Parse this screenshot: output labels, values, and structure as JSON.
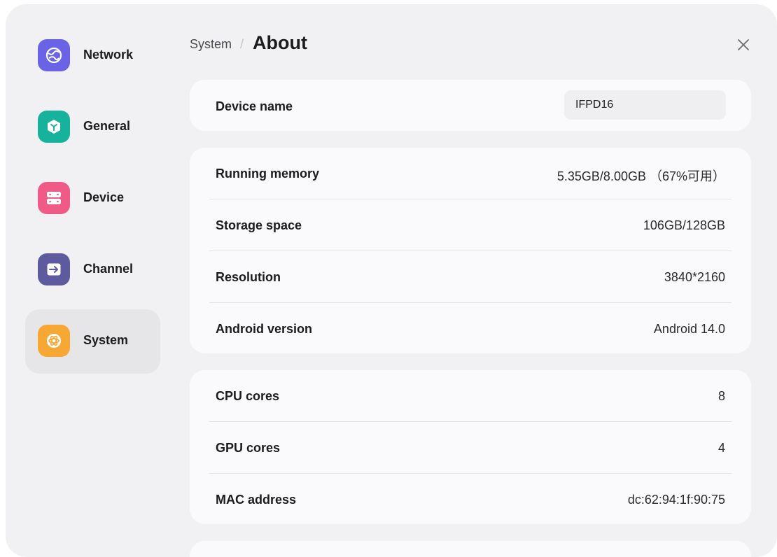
{
  "sidebar": {
    "items": [
      {
        "label": "Network",
        "icon": "network-globe-icon",
        "color": "#6b63e6"
      },
      {
        "label": "General",
        "icon": "general-cube-icon",
        "color": "#17b29b"
      },
      {
        "label": "Device",
        "icon": "device-server-icon",
        "color": "#ef5a86"
      },
      {
        "label": "Channel",
        "icon": "channel-input-icon",
        "color": "#5e5a9e"
      },
      {
        "label": "System",
        "icon": "system-atom-icon",
        "color": "#f7a733",
        "active": true
      }
    ]
  },
  "header": {
    "breadcrumb": "System",
    "separator": "/",
    "title": "About"
  },
  "device_name": {
    "label": "Device name",
    "value": "IFPD16"
  },
  "info_group_1": [
    {
      "label": "Running memory",
      "value": "5.35GB/8.00GB （67%可用）"
    },
    {
      "label": "Storage space",
      "value": "106GB/128GB"
    },
    {
      "label": "Resolution",
      "value": "3840*2160"
    },
    {
      "label": "Android version",
      "value": "Android 14.0"
    }
  ],
  "info_group_2": [
    {
      "label": "CPU cores",
      "value": "8"
    },
    {
      "label": "GPU cores",
      "value": "4"
    },
    {
      "label": "MAC address",
      "value": "dc:62:94:1f:90:75"
    }
  ]
}
